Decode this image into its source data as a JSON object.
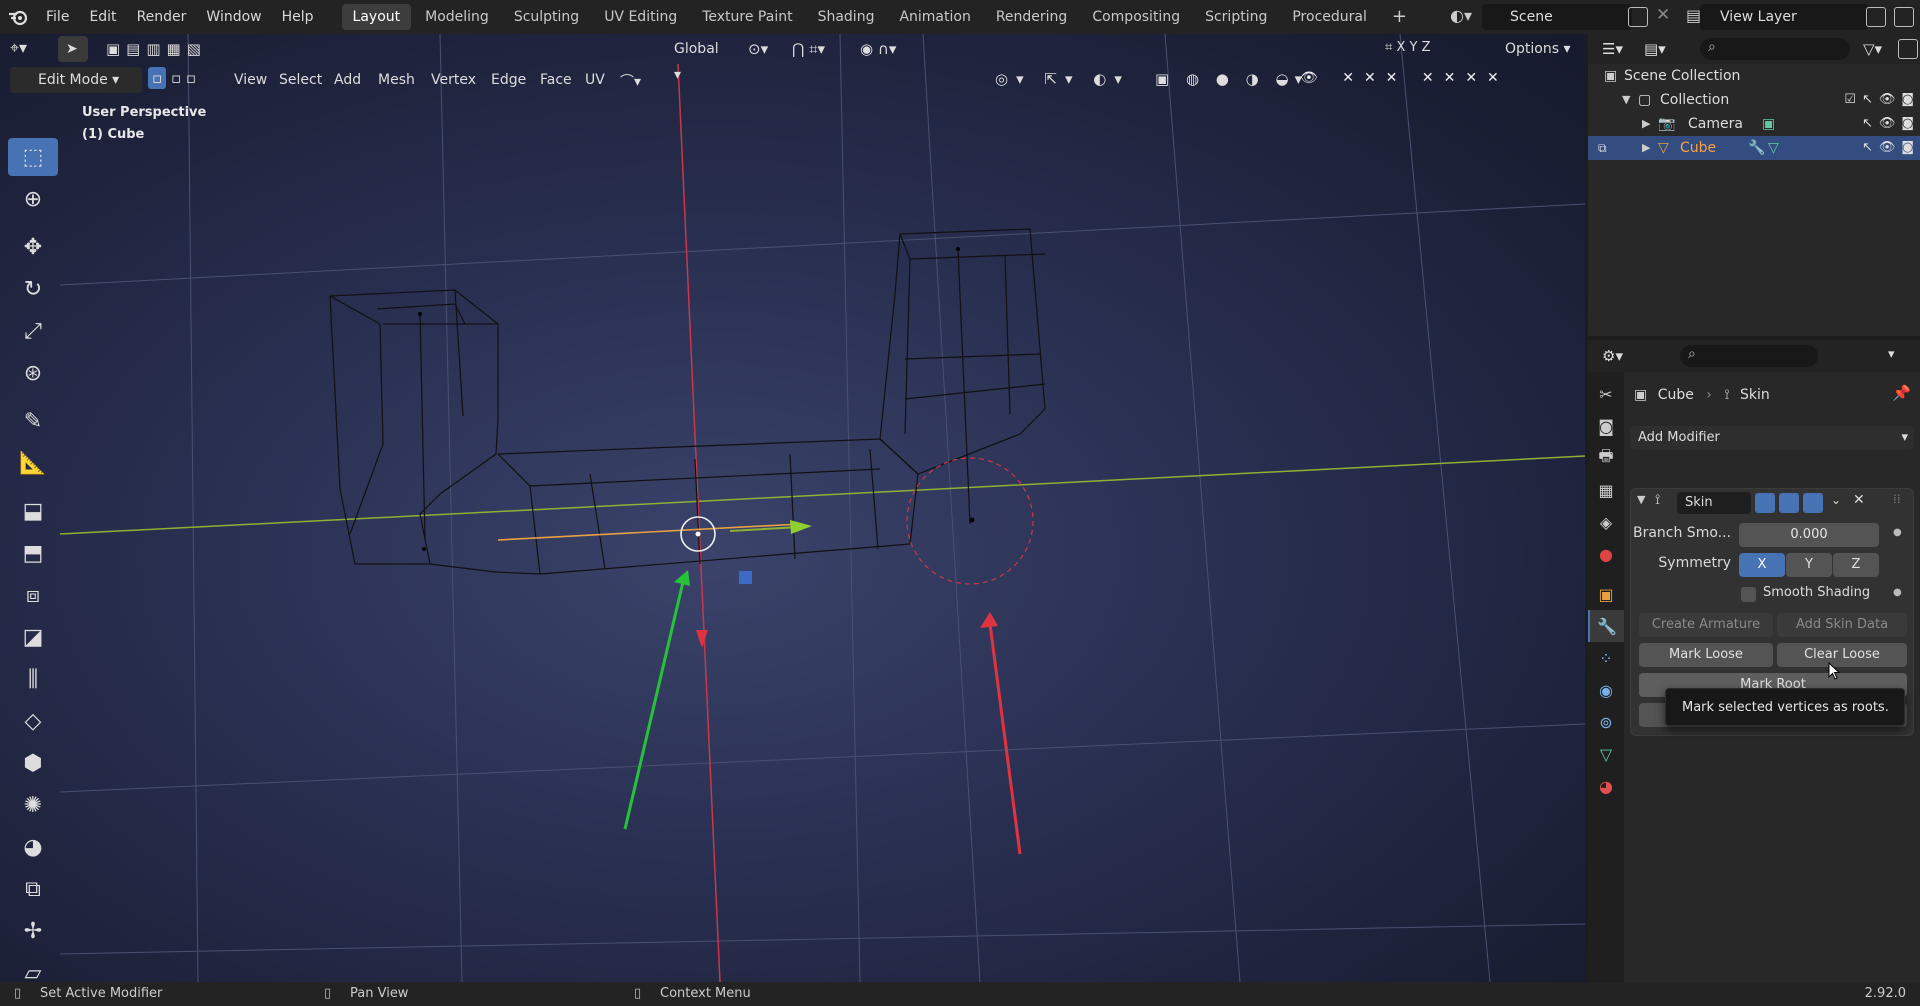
{
  "menu": [
    "File",
    "Edit",
    "Render",
    "Window",
    "Help"
  ],
  "workspace_tabs": [
    "Layout",
    "Modeling",
    "Sculpting",
    "UV Editing",
    "Texture Paint",
    "Shading",
    "Animation",
    "Rendering",
    "Compositing",
    "Scripting",
    "Procedural"
  ],
  "active_workspace": "Layout",
  "scene": "Scene",
  "view_layer": "View Layer",
  "viewport": {
    "transform_orientation": "Global",
    "options_label": "Options",
    "axis_labels": [
      "X",
      "Y",
      "Z"
    ],
    "mode": "Edit Mode",
    "header_menu": [
      "View",
      "Select",
      "Add",
      "Mesh",
      "Vertex",
      "Edge",
      "Face",
      "UV"
    ],
    "perspective_label": "User Perspective",
    "object_label": "(1) Cube"
  },
  "outliner": {
    "root": "Scene Collection",
    "items": [
      {
        "label": "Collection"
      },
      {
        "label": "Camera"
      },
      {
        "label": "Cube",
        "selected": true
      }
    ]
  },
  "properties": {
    "breadcrumb_object": "Cube",
    "breadcrumb_modifier": "Skin",
    "add_modifier_label": "Add Modifier",
    "modifier": {
      "name": "Skin",
      "branch_smoothing_label": "Branch Smo...",
      "branch_smoothing_value": "0.000",
      "symmetry_label": "Symmetry",
      "symmetry_axes": [
        "X",
        "Y",
        "Z"
      ],
      "symmetry_active": "X",
      "smooth_shading_label": "Smooth Shading",
      "smooth_shading_checked": false,
      "create_armature_label": "Create Armature",
      "add_skin_data_label": "Add Skin Data",
      "mark_loose_label": "Mark Loose",
      "clear_loose_label": "Clear Loose",
      "mark_root_label": "Mark Root"
    },
    "tooltip": "Mark selected vertices as roots."
  },
  "statusbar": {
    "left": "Set Active Modifier",
    "middle": "Pan View",
    "right": "Context Menu",
    "version": "2.92.0"
  }
}
